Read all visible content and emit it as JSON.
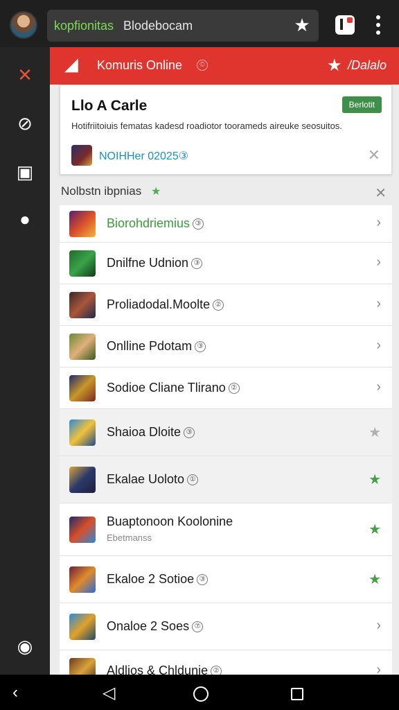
{
  "browser": {
    "url_domain": "kopfionitas",
    "url_path": "Blodebocam"
  },
  "header": {
    "title": "Komuris Online",
    "title_badge": "©",
    "right_label": "/Dalalo"
  },
  "card": {
    "title": "Llo A Carle",
    "button_label": "Berlotit",
    "description": "Hotifriitoiuis fematas kadesd roadiotor toorameds aireuke seosuitos.",
    "link_text": "NOIHHer 02025③"
  },
  "section": {
    "title": "Nolbstn ibpnias"
  },
  "items": [
    {
      "name": "Biorohdriemius",
      "badge": "③",
      "trail": "chevron",
      "green": true,
      "colors": [
        "#5b1f6b",
        "#d94f2a",
        "#f2b53a"
      ]
    },
    {
      "name": "Dnilfne Udnion",
      "badge": "③",
      "trail": "chevron",
      "colors": [
        "#1f6b2a",
        "#3aa34a",
        "#0f3a18"
      ]
    },
    {
      "name": "Proliadodal.Moolte",
      "badge": "②",
      "trail": "chevron",
      "colors": [
        "#3a2a2a",
        "#a8553a",
        "#1f2a4a"
      ]
    },
    {
      "name": "Onlline Pdotam",
      "badge": "③",
      "trail": "chevron",
      "colors": [
        "#6b8a3a",
        "#e0b07a",
        "#3a5a1f"
      ]
    },
    {
      "name": "Sodioe Cliane Tlirano",
      "badge": "②",
      "trail": "chevron",
      "colors": [
        "#1f2a6b",
        "#c9962a",
        "#7a2a1f"
      ]
    },
    {
      "name": "Shaioa Dloite",
      "badge": "③",
      "trail": "grey-star",
      "alt": true,
      "colors": [
        "#2a8ad9",
        "#f2c23a",
        "#1f4a8a"
      ]
    },
    {
      "name": "Ekalae Uoloto",
      "badge": "①",
      "trail": "green-star",
      "alt": true,
      "colors": [
        "#d9a23a",
        "#2a3a6b",
        "#1f1f3a"
      ]
    },
    {
      "name": "Buaptonoon Koolonine",
      "subtitle": "Ebetmanss",
      "trail": "green-star",
      "colors": [
        "#1f2a6b",
        "#d94f2a",
        "#2a8ad9"
      ]
    },
    {
      "name": "Ekaloe 2 Sotioe",
      "badge": "③",
      "trail": "green-star",
      "colors": [
        "#6b1f3a",
        "#e08a2a",
        "#2a6bd9"
      ]
    },
    {
      "name": "Onaloe 2 Soes",
      "badge": "⑦",
      "trail": "chevron",
      "colors": [
        "#2a8ad9",
        "#e0a02a",
        "#1f4a6b"
      ]
    },
    {
      "name": "Aldlios & Chldunie",
      "badge": "②",
      "trail": "chevron",
      "colors": [
        "#6b3a1f",
        "#d9a23a",
        "#3a2a1f"
      ]
    }
  ]
}
